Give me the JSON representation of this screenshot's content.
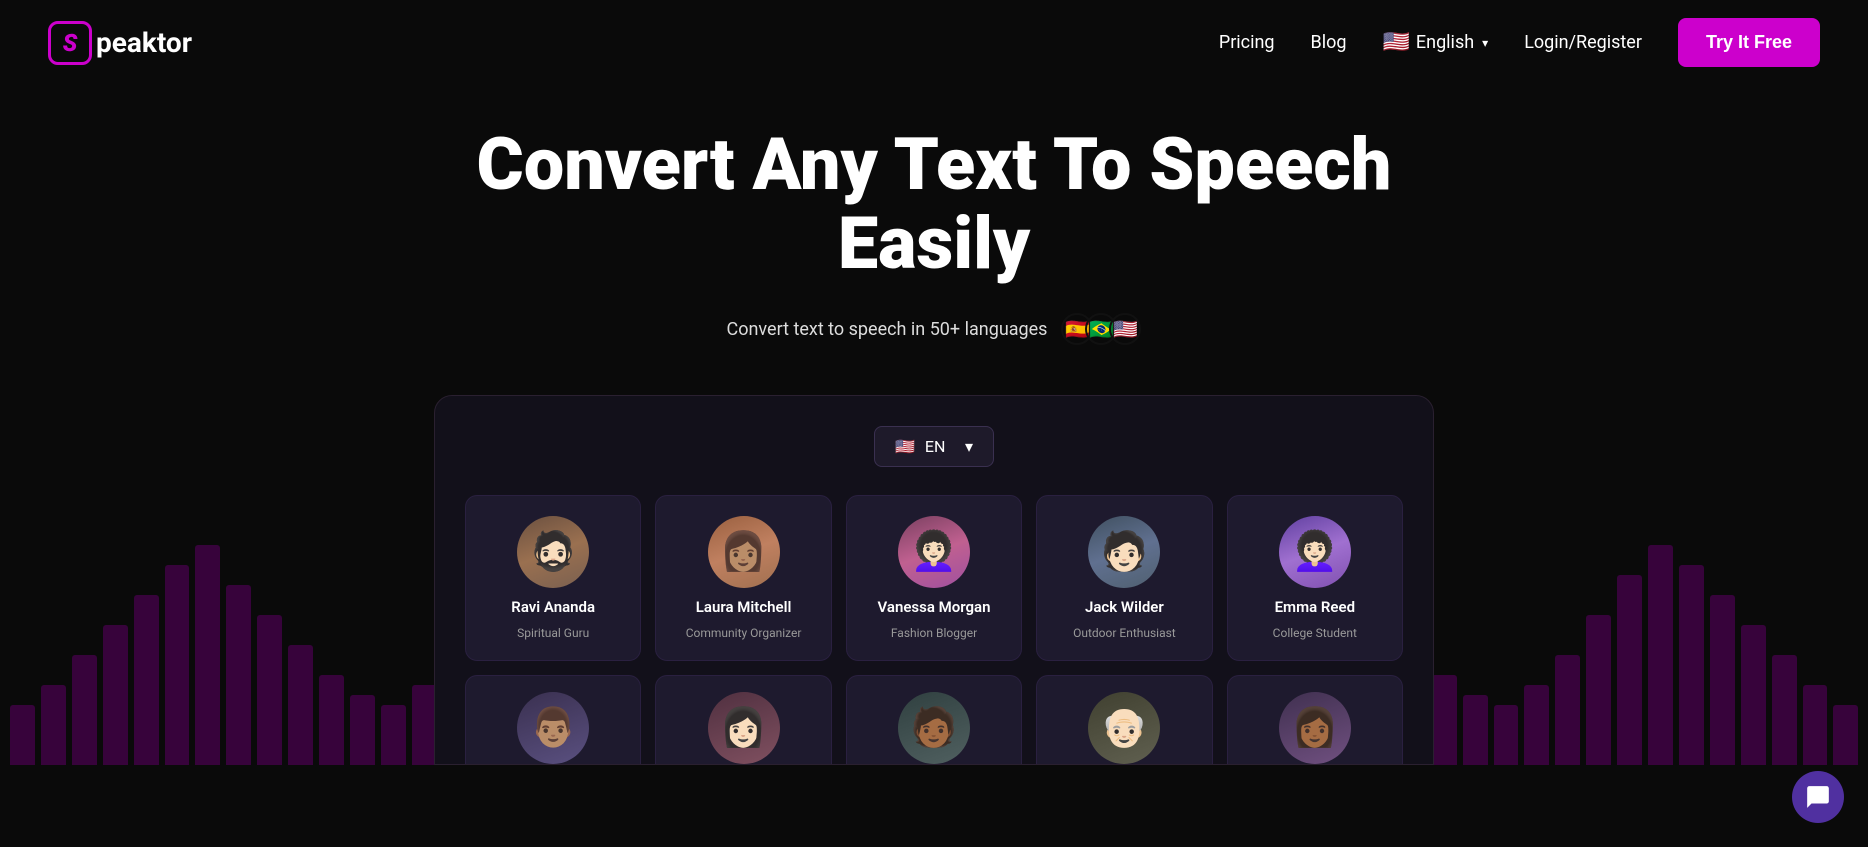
{
  "nav": {
    "logo_letter": "S",
    "logo_name": "peaktor",
    "links": [
      {
        "id": "pricing",
        "label": "Pricing"
      },
      {
        "id": "blog",
        "label": "Blog"
      }
    ],
    "language": {
      "flag": "🇺🇸",
      "label": "English"
    },
    "login_label": "Login/Register",
    "cta_label": "Try It Free"
  },
  "hero": {
    "title": "Convert Any Text To Speech Easily",
    "subtitle": "Convert text to speech in 50+ languages",
    "flags": [
      "🇪🇸",
      "🇧🇷",
      "🇺🇸"
    ]
  },
  "app": {
    "language_selector": {
      "flag": "🇺🇸",
      "code": "EN"
    },
    "voices": [
      {
        "id": "ravi",
        "name": "Ravi Ananda",
        "role": "Spiritual Guru",
        "avatar_color_start": "#5a4030",
        "avatar_color_end": "#8a6040",
        "emoji": "🧔"
      },
      {
        "id": "laura",
        "name": "Laura Mitchell",
        "role": "Community Organizer",
        "avatar_color_start": "#8a5030",
        "avatar_color_end": "#c07040",
        "emoji": "👩"
      },
      {
        "id": "vanessa",
        "name": "Vanessa Morgan",
        "role": "Fashion Blogger",
        "avatar_color_start": "#6a3060",
        "avatar_color_end": "#b05080",
        "emoji": "👩‍🦱"
      },
      {
        "id": "jack",
        "name": "Jack Wilder",
        "role": "Outdoor Enthusiast",
        "avatar_color_start": "#304060",
        "avatar_color_end": "#506080",
        "emoji": "🧑"
      },
      {
        "id": "emma",
        "name": "Emma Reed",
        "role": "College Student",
        "avatar_color_start": "#5030a0",
        "avatar_color_end": "#9060d0",
        "emoji": "👩‍🦰"
      }
    ],
    "second_row_count": 2
  },
  "chat": {
    "icon_label": "chat-bubble"
  }
}
